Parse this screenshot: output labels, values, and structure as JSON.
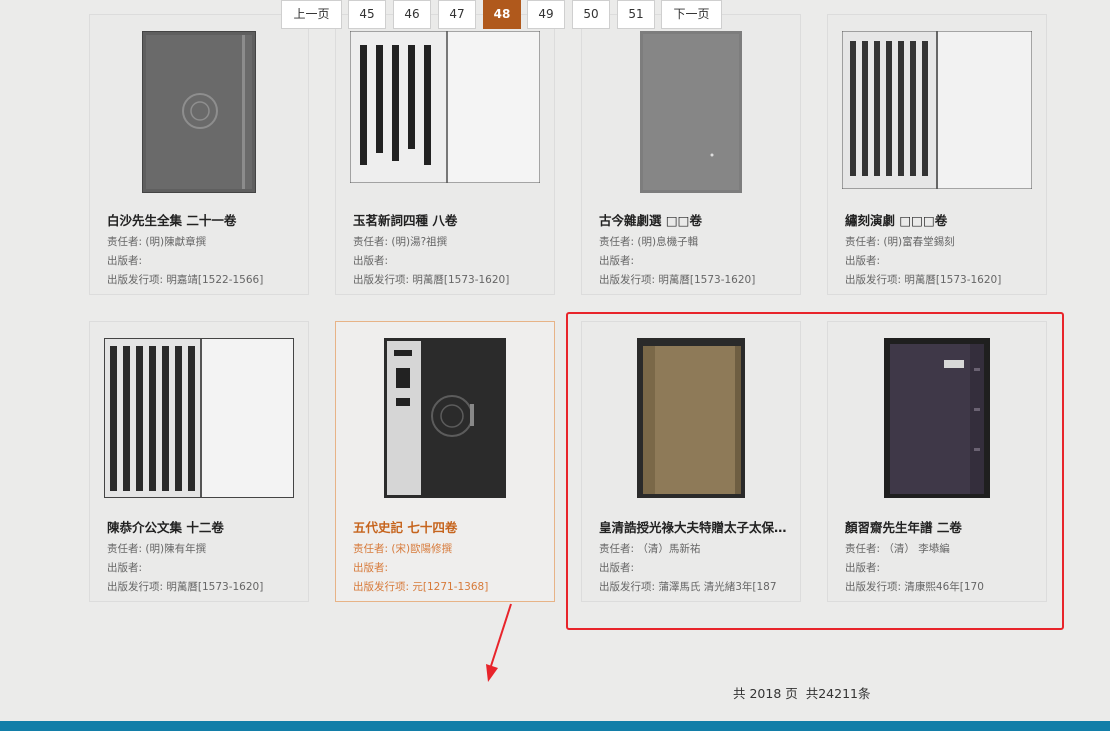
{
  "labels": {
    "responsible": "责任者:",
    "publisher": "出版者:",
    "publication": "出版发行项:"
  },
  "books": [
    {
      "title": "白沙先生全集 二十一卷",
      "author": "(明)陳獻章撰",
      "publisher": "",
      "publication": "明嘉靖[1522-1566]"
    },
    {
      "title": "玉茗新詞四種 八卷",
      "author": "(明)湯?祖撰",
      "publisher": "",
      "publication": "明萬曆[1573-1620]"
    },
    {
      "title": "古今雜劇選 □□卷",
      "author": "(明)息機子輯",
      "publisher": "",
      "publication": "明萬曆[1573-1620]"
    },
    {
      "title": "繡刻演劇 □□□卷",
      "author": "(明)富春堂錫刻",
      "publisher": "",
      "publication": "明萬曆[1573-1620]"
    },
    {
      "title": "陳恭介公文集 十二卷",
      "author": "(明)陳有年撰",
      "publisher": "",
      "publication": "明萬曆[1573-1620]"
    },
    {
      "title": "五代史記 七十四卷",
      "author": "(宋)歐陽修撰",
      "publisher": "",
      "publication": "元[1271-1368]"
    },
    {
      "title": "皇清誥授光祿大夫特贈太子太保…",
      "author": "（清）馬新祐",
      "publisher": "",
      "publication": "蒲澤馬氏 清光緒3年[187"
    },
    {
      "title": "顏習齋先生年譜 二卷",
      "author": "（清） 李塨編",
      "publisher": "",
      "publication": "清康熙46年[170"
    }
  ],
  "pagination": {
    "prev": "上一页",
    "pages": [
      "45",
      "46",
      "47",
      "48",
      "49",
      "50",
      "51"
    ],
    "current": "48",
    "next": "下一页",
    "total_pages_text": "共 2018 页",
    "total_items_text": "共24211条"
  },
  "colors": {
    "accent": "#b0591c",
    "highlight_box": "#e8242b",
    "footer": "#127ea8"
  }
}
